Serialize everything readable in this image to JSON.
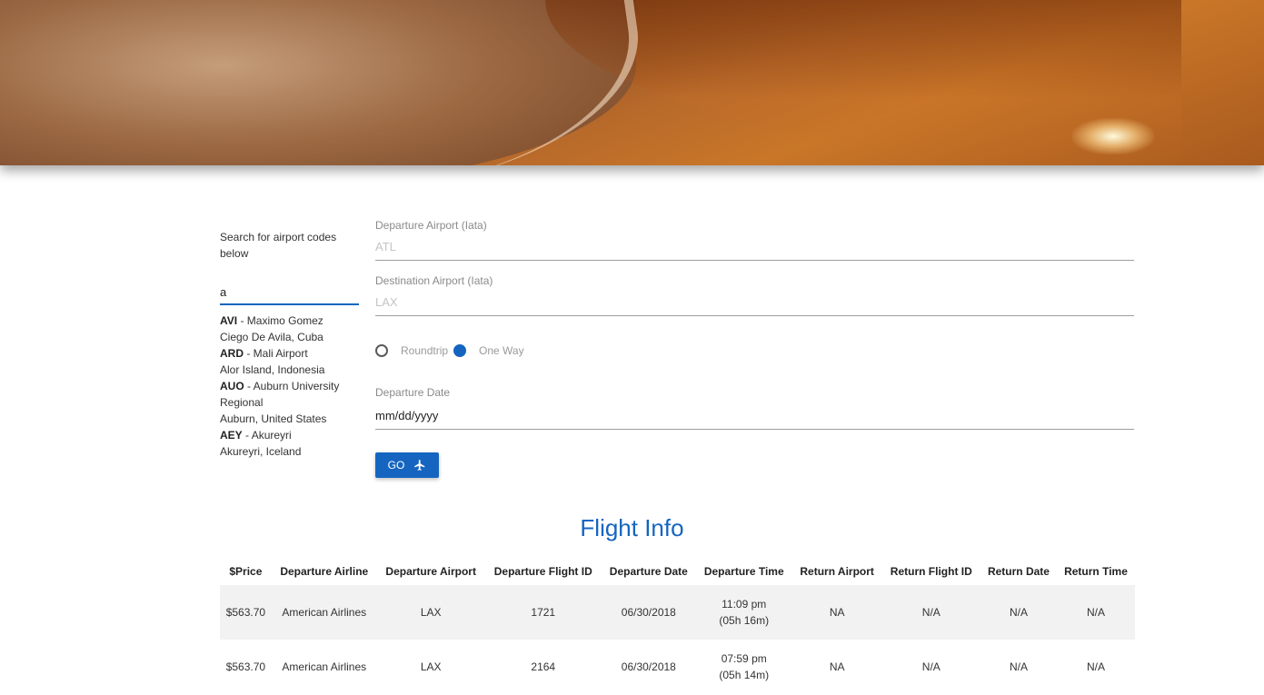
{
  "sidebar": {
    "hint": "Search for airport codes below",
    "search_value": "a",
    "results": [
      {
        "code": "AVI",
        "name": " - Maximo Gomez",
        "location": "Ciego De Avila, Cuba"
      },
      {
        "code": "ARD",
        "name": " - Mali Airport",
        "location": "Alor Island, Indonesia"
      },
      {
        "code": "AUO",
        "name": " - Auburn University Regional",
        "location": "Auburn, United States"
      },
      {
        "code": "AEY",
        "name": " - Akureyri",
        "location": "Akureyri, Iceland"
      }
    ]
  },
  "form": {
    "departure": {
      "label": "Departure Airport (Iata)",
      "placeholder": "ATL",
      "value": ""
    },
    "destination": {
      "label": "Destination Airport (Iata)",
      "placeholder": "LAX",
      "value": ""
    },
    "trip_type": {
      "options": [
        "Roundtrip",
        "One Way"
      ],
      "selected": "One Way"
    },
    "date": {
      "label": "Departure Date",
      "value": "mm/dd/yyyy"
    },
    "go_label": "GO"
  },
  "results_title": "Flight Info",
  "table": {
    "headers": [
      "$Price",
      "Departure Airline",
      "Departure Airport",
      "Departure Flight ID",
      "Departure Date",
      "Departure Time",
      "Return Airport",
      "Return Flight ID",
      "Return Date",
      "Return Time"
    ],
    "rows": [
      [
        "$563.70",
        "American Airlines",
        "LAX",
        "1721",
        "06/30/2018",
        "11:09 pm",
        "(05h 16m)",
        "NA",
        "N/A",
        "N/A",
        "N/A"
      ],
      [
        "$563.70",
        "American Airlines",
        "LAX",
        "2164",
        "06/30/2018",
        "07:59 pm",
        "(05h 14m)",
        "NA",
        "N/A",
        "N/A",
        "N/A"
      ]
    ]
  },
  "colors": {
    "accent": "#1565c0",
    "row_stripe": "#f2f2f2"
  },
  "icons": {
    "go": "airplane-icon",
    "hero": "beach-banner-image"
  }
}
